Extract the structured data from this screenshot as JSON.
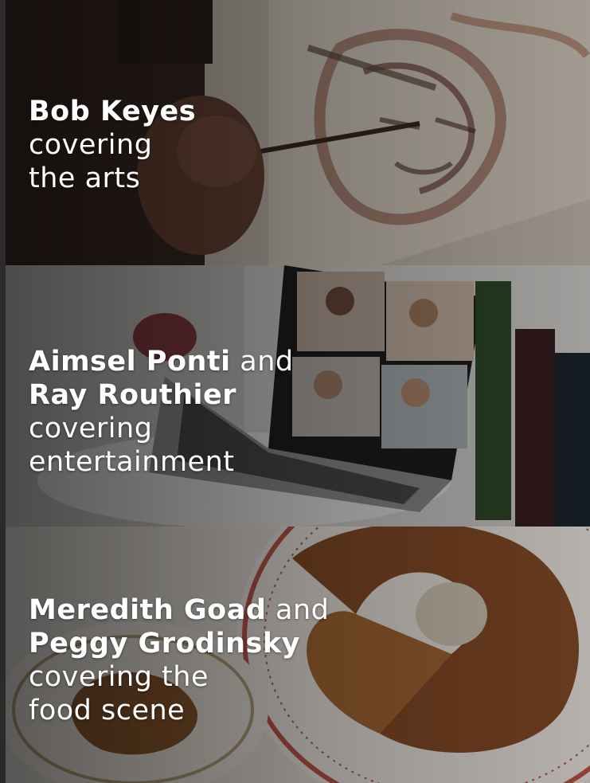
{
  "panels": [
    {
      "names": [
        {
          "name": "Bob Keyes",
          "joiner": ""
        }
      ],
      "subtitle_lines": [
        "covering",
        "the arts"
      ]
    },
    {
      "names": [
        {
          "name": "Aimsel Ponti",
          "joiner": "and"
        },
        {
          "name": "Ray Routhier",
          "joiner": ""
        }
      ],
      "subtitle_lines": [
        "covering",
        "entertainment"
      ]
    },
    {
      "names": [
        {
          "name": "Meredith Goad",
          "joiner": "and"
        },
        {
          "name": "Peggy Grodinsky",
          "joiner": ""
        }
      ],
      "subtitle_lines": [
        "covering the",
        "food scene"
      ]
    }
  ],
  "icons": [
    "painting-photo",
    "laptop-video-call-photo",
    "apple-cake-photo"
  ]
}
